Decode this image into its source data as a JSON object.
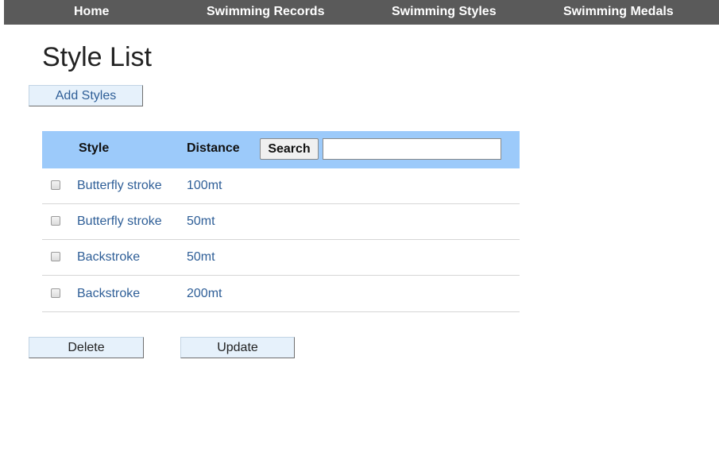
{
  "nav": {
    "items": [
      {
        "label": "Home"
      },
      {
        "label": "Swimming Records"
      },
      {
        "label": "Swimming Styles"
      },
      {
        "label": "Swimming Medals"
      }
    ]
  },
  "page": {
    "title": "Style List",
    "add_label": "Add Styles"
  },
  "table": {
    "columns": {
      "style": "Style",
      "distance": "Distance"
    },
    "search_label": "Search",
    "search_value": "",
    "rows": [
      {
        "style": "Butterfly stroke",
        "distance": "100mt",
        "checked": false
      },
      {
        "style": "Butterfly stroke",
        "distance": "50mt",
        "checked": false
      },
      {
        "style": "Backstroke",
        "distance": "50mt",
        "checked": false
      },
      {
        "style": "Backstroke",
        "distance": "200mt",
        "checked": false
      }
    ]
  },
  "actions": {
    "delete_label": "Delete",
    "update_label": "Update"
  },
  "colors": {
    "nav_bg": "#5a5a5a",
    "header_bg": "#9ccafa",
    "link": "#2e5e97",
    "button_bg": "#e6f1fb"
  }
}
